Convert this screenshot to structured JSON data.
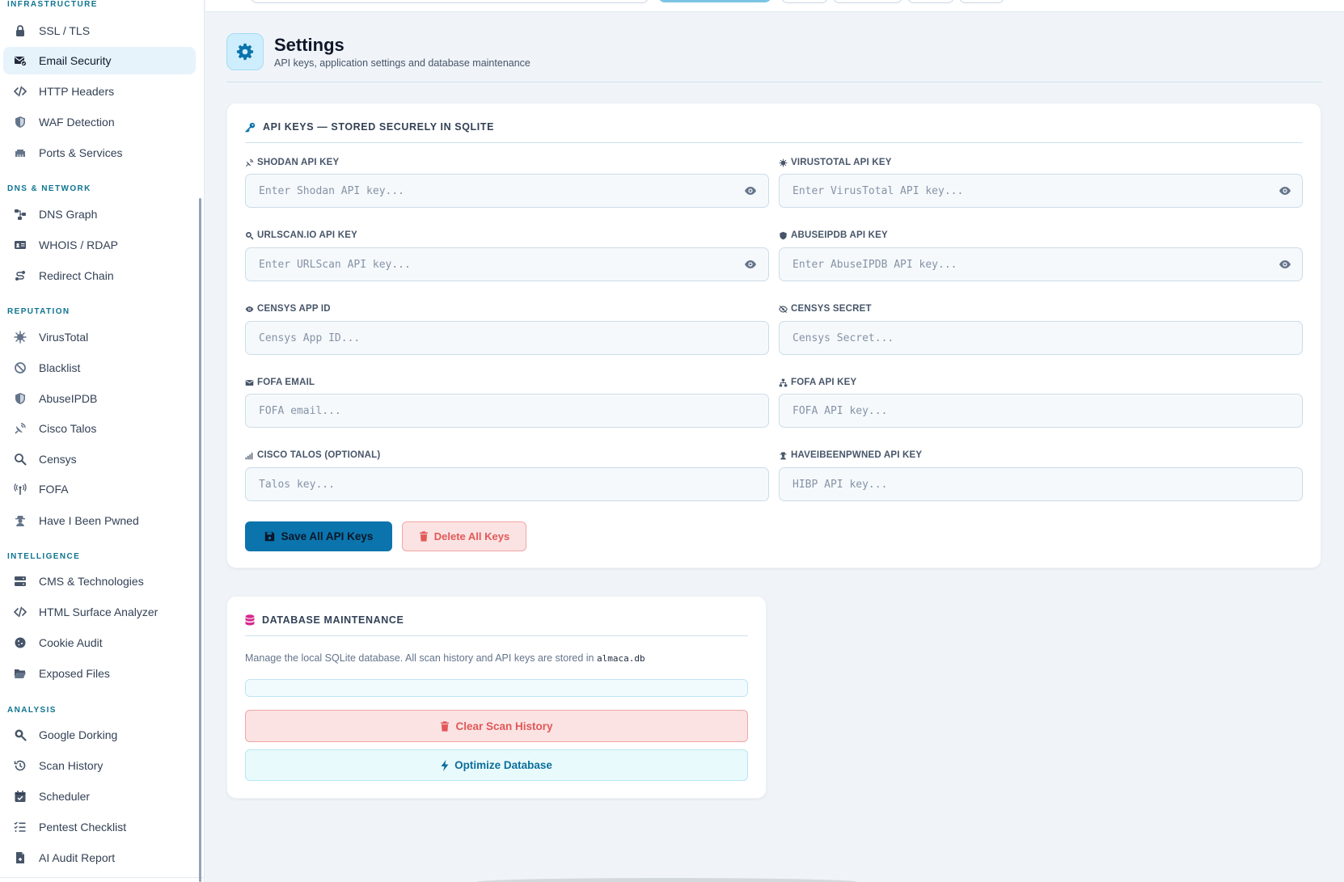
{
  "sidebar": {
    "sections": {
      "infrastructure": "INFRASTRUCTURE",
      "dns": "DNS & NETWORK",
      "reputation": "REPUTATION",
      "intelligence": "INTELLIGENCE",
      "analysis": "ANALYSIS"
    },
    "items": {
      "ssl": "SSL / TLS",
      "email": "Email Security",
      "http": "HTTP Headers",
      "waf": "WAF Detection",
      "ports": "Ports & Services",
      "dnsgraph": "DNS Graph",
      "whois": "WHOIS / RDAP",
      "redirect": "Redirect Chain",
      "virustotal": "VirusTotal",
      "blacklist": "Blacklist",
      "abuseipdb": "AbuseIPDB",
      "talos": "Cisco Talos",
      "censys": "Censys",
      "fofa": "FOFA",
      "hibp": "Have I Been Pwned",
      "cms": "CMS & Technologies",
      "htmlsurface": "HTML Surface Analyzer",
      "cookie": "Cookie Audit",
      "exposed": "Exposed Files",
      "dorking": "Google Dorking",
      "history": "Scan History",
      "scheduler": "Scheduler",
      "pentest": "Pentest Checklist",
      "aiaudit": "AI Audit Report"
    }
  },
  "header": {
    "title": "Settings",
    "subtitle": "API keys, application settings and database maintenance"
  },
  "api_keys": {
    "title": "API KEYS — STORED SECURELY IN SQLITE",
    "fields": {
      "shodan": {
        "label": "SHODAN API KEY",
        "placeholder": "Enter Shodan API key...",
        "value": ""
      },
      "virustotal": {
        "label": "VIRUSTOTAL API KEY",
        "placeholder": "Enter VirusTotal API key...",
        "value": ""
      },
      "urlscan": {
        "label": "URLSCAN.IO API KEY",
        "placeholder": "Enter URLScan API key...",
        "value": ""
      },
      "abuseipdb": {
        "label": "ABUSEIPDB API KEY",
        "placeholder": "Enter AbuseIPDB API key...",
        "value": ""
      },
      "censys_id": {
        "label": "CENSYS APP ID",
        "placeholder": "Censys App ID...",
        "value": ""
      },
      "censys_secret": {
        "label": "CENSYS SECRET",
        "placeholder": "Censys Secret...",
        "value": ""
      },
      "fofa_email": {
        "label": "FOFA EMAIL",
        "placeholder": "FOFA email...",
        "value": ""
      },
      "fofa_key": {
        "label": "FOFA API KEY",
        "placeholder": "FOFA API key...",
        "value": ""
      },
      "talos": {
        "label": "CISCO TALOS (OPTIONAL)",
        "placeholder": "Talos key...",
        "value": ""
      },
      "hibp": {
        "label": "HAVEIBEENPWNED API KEY",
        "placeholder": "HIBP API key...",
        "value": ""
      }
    },
    "save_label": "Save All API Keys",
    "delete_label": "Delete All Keys"
  },
  "database": {
    "title": "DATABASE MAINTENANCE",
    "description": "Manage the local SQLite database. All scan history and API keys are stored in",
    "db_file": "almaca.db",
    "clear_label": "Clear Scan History",
    "optimize_label": "Optimize Database"
  },
  "colors": {
    "accent": "#0b74ad",
    "danger": "#e25858",
    "section_text": "#0e7490",
    "db_icon": "#d6288e"
  }
}
